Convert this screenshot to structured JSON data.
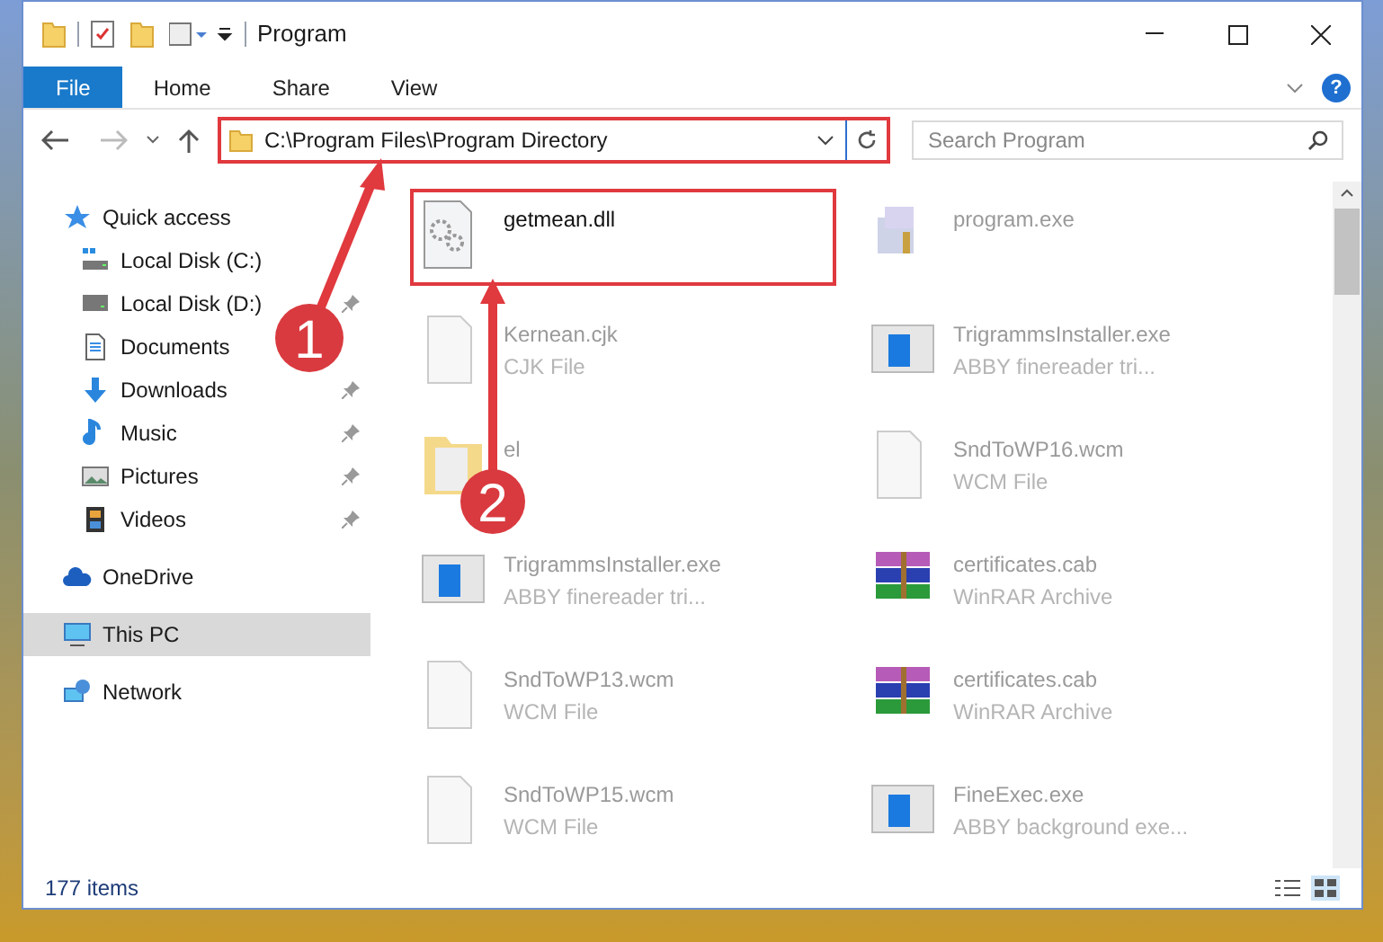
{
  "window": {
    "title": "Program"
  },
  "ribbon_tabs": [
    {
      "label": "File",
      "selected": true
    },
    {
      "label": "Home",
      "selected": false
    },
    {
      "label": "Share",
      "selected": false
    },
    {
      "label": "View",
      "selected": false
    }
  ],
  "address_bar": {
    "value": "C:\\Program Files\\Program Directory",
    "highlighted": true
  },
  "search": {
    "placeholder": "Search Program"
  },
  "help_button": {
    "label": "?"
  },
  "navigation": [
    {
      "label": "Quick access",
      "selected": false,
      "children": [
        {
          "label": "Local Disk (C:)",
          "selected": false,
          "pinned": false
        },
        {
          "label": "Local Disk (D:)",
          "selected": false,
          "pinned": true
        },
        {
          "label": "Documents",
          "selected": false,
          "pinned": false
        },
        {
          "label": "Downloads",
          "selected": false,
          "pinned": true
        },
        {
          "label": "Music",
          "selected": false,
          "pinned": true
        },
        {
          "label": "Pictures",
          "selected": false,
          "pinned": true
        },
        {
          "label": "Videos",
          "selected": false,
          "pinned": true
        }
      ]
    },
    {
      "label": "OneDrive",
      "selected": false
    },
    {
      "label": "This PC",
      "selected": true
    },
    {
      "label": "Network",
      "selected": false
    }
  ],
  "files": [
    {
      "name": "getmean.dll",
      "kind": "dll",
      "highlighted": true
    },
    {
      "name": "program.exe",
      "kind": "exe",
      "highlighted": false
    },
    {
      "name": "Kernean.cjk",
      "type": "CJK File",
      "kind": "blank",
      "highlighted": false
    },
    {
      "name": "TrigrammsInstaller.exe",
      "type": "ABBY finereader tri...",
      "kind": "app",
      "highlighted": false
    },
    {
      "name": "el",
      "kind": "folder",
      "highlighted": false
    },
    {
      "name": "SndToWP16.wcm",
      "type": "WCM File",
      "kind": "blank",
      "highlighted": false
    },
    {
      "name": "TrigrammsInstaller.exe",
      "type": "ABBY finereader tri...",
      "kind": "app",
      "highlighted": false
    },
    {
      "name": "certificates.cab",
      "type": "WinRAR Archive",
      "kind": "archive",
      "highlighted": false
    },
    {
      "name": "SndToWP13.wcm",
      "type": "WCM File",
      "kind": "blank",
      "highlighted": false
    },
    {
      "name": "certificates.cab",
      "type": "WinRAR Archive",
      "kind": "archive",
      "highlighted": false
    },
    {
      "name": "SndToWP15.wcm",
      "type": "WCM File",
      "kind": "blank",
      "highlighted": false
    },
    {
      "name": "FineExec.exe",
      "type": "ABBY background exe...",
      "kind": "app",
      "highlighted": false
    }
  ],
  "status_bar": {
    "item_count": "177 items"
  },
  "callouts": [
    {
      "number": "1"
    },
    {
      "number": "2"
    }
  ]
}
